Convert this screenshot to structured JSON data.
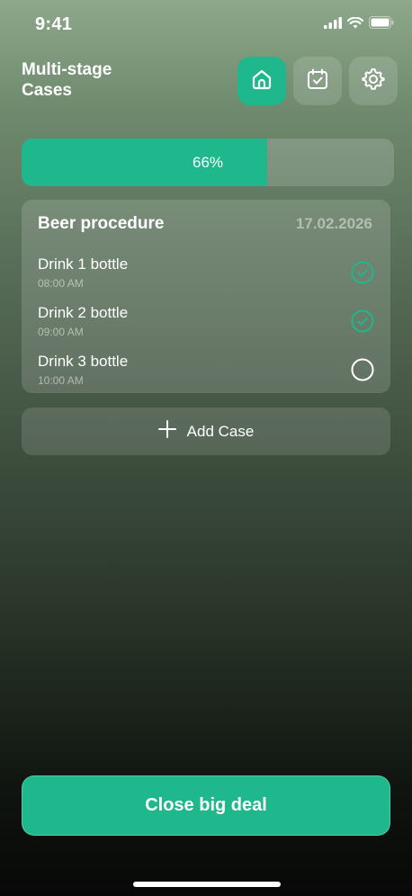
{
  "status_bar": {
    "time": "9:41",
    "icons": [
      "cellular-signal-icon",
      "wifi-icon",
      "battery-icon"
    ]
  },
  "header": {
    "title": "Multi-stage Cases",
    "nav": [
      {
        "name": "home",
        "icon": "home-icon",
        "active": true
      },
      {
        "name": "calendar",
        "icon": "calendar-check-icon",
        "active": false
      },
      {
        "name": "settings",
        "icon": "gear-icon",
        "active": false
      }
    ]
  },
  "progress": {
    "value": 0.66,
    "label": "66%"
  },
  "case": {
    "title": "Beer procedure",
    "date": "17.02.2026",
    "steps": [
      {
        "label": "Drink 1 bottle",
        "time": "08:00 AM",
        "done": true
      },
      {
        "label": "Drink 2 bottle",
        "time": "09:00 AM",
        "done": true
      },
      {
        "label": "Drink 3 bottle",
        "time": "10:00 AM",
        "done": false
      }
    ]
  },
  "add_case": {
    "label": "Add Case",
    "icon": "plus-icon"
  },
  "cta": {
    "label": "Close big deal"
  },
  "colors": {
    "accent": "#1fb78c",
    "card": "rgba(255,255,255,0.15)",
    "muted_text": "rgba(255,255,255,0.5)"
  }
}
